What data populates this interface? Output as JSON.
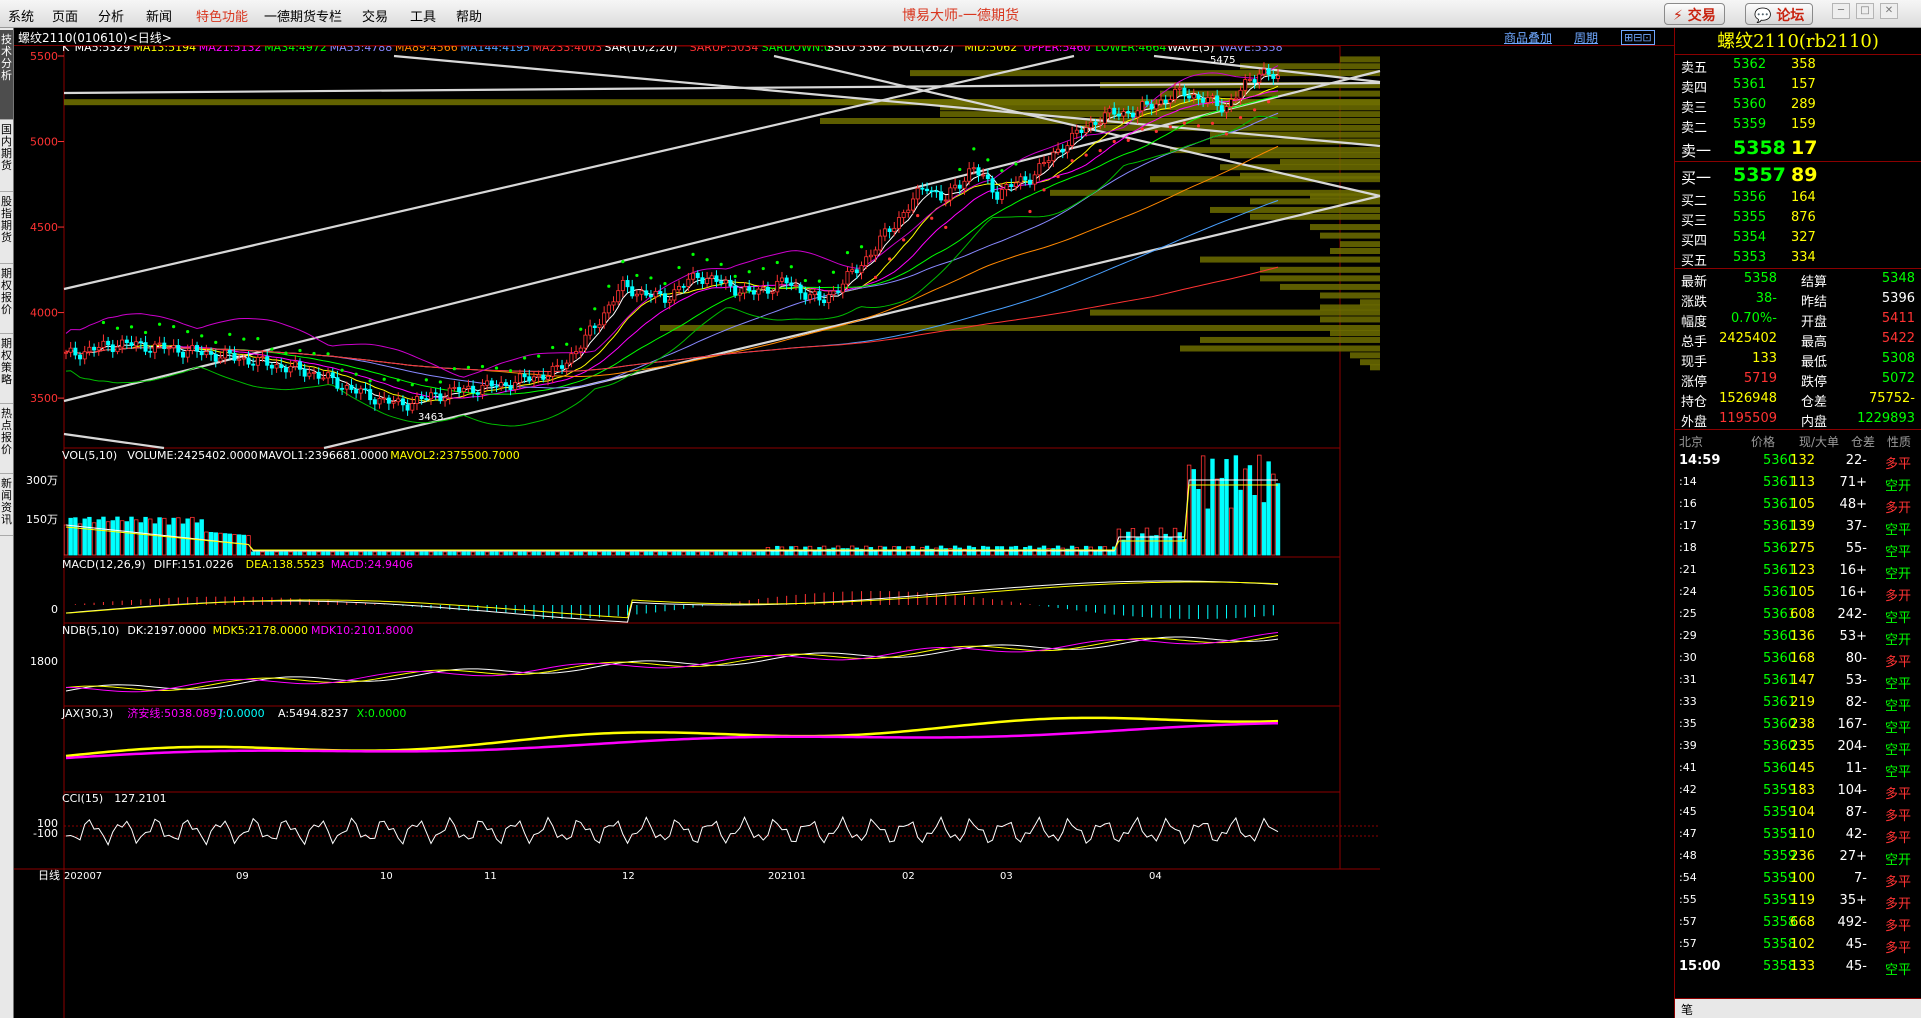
{
  "app_title": "博易大师-一德期货",
  "menu": [
    "系统",
    "页面",
    "分析",
    "新闻",
    "特色功能",
    "一德期货专栏",
    "交易",
    "工具",
    "帮助"
  ],
  "menu_special_index": 4,
  "top_buttons": {
    "trade": "交易",
    "forum": "论坛"
  },
  "left_tabs": [
    "技术分析",
    "国内期货",
    "股指期货",
    "期权报价",
    "期权策略",
    "热点报价",
    "新闻资讯"
  ],
  "chart_header": {
    "symbol": "螺纹2110(010610)<日线>",
    "overlay": "商品叠加",
    "period": "周期"
  },
  "main_indicator": [
    {
      "t": "K",
      "c": "#ffffff"
    },
    {
      "t": "MA5:5329",
      "c": "#ffffff"
    },
    {
      "t": "MA13:5194",
      "c": "#ffff00"
    },
    {
      "t": "MA21:5132",
      "c": "#ff00ff"
    },
    {
      "t": "MA34:4972",
      "c": "#00ff00"
    },
    {
      "t": "MA55:4788",
      "c": "#8888ff"
    },
    {
      "t": "MA89:4566",
      "c": "#ff8800"
    },
    {
      "t": "MA144:4195",
      "c": "#4aa0ff"
    },
    {
      "t": "MA233:4003",
      "c": "#ff3333"
    },
    {
      "t": "SAR(10,2,20)",
      "c": "#ffffff"
    },
    {
      "t": "SARUP:5034",
      "c": "#ff3333"
    },
    {
      "t": "SARDOWN:0",
      "c": "#00ff00"
    },
    {
      "t": "SSLO 5362",
      "c": "#ffffff"
    },
    {
      "t": "BOLL(26,2)",
      "c": "#ffffff"
    },
    {
      "t": "MID:5062",
      "c": "#ffff00"
    },
    {
      "t": "UPPER:5460",
      "c": "#ff00ff"
    },
    {
      "t": "LOWER:4664",
      "c": "#00ff00"
    },
    {
      "t": "WAVE(5)",
      "c": "#ffffff"
    },
    {
      "t": "WAVE:5358",
      "c": "#8888ff"
    }
  ],
  "main_yaxis": [
    "5500",
    "5000",
    "4500",
    "4000",
    "3500"
  ],
  "high_label": "5475",
  "low_label": "3463",
  "vol_indicator": [
    {
      "t": "VOL(5,10)",
      "c": "#ffffff"
    },
    {
      "t": "VOLUME:2425402.0000",
      "c": "#ffffff"
    },
    {
      "t": "MAVOL1:2396681.0000",
      "c": "#ffffff"
    },
    {
      "t": "MAVOL2:2375500.7000",
      "c": "#ffff00"
    }
  ],
  "vol_yaxis": [
    "300万",
    "150万"
  ],
  "macd_indicator": [
    {
      "t": "MACD(12,26,9)",
      "c": "#ffffff"
    },
    {
      "t": "DIFF:151.0226",
      "c": "#ffffff"
    },
    {
      "t": "DEA:138.5523",
      "c": "#ffff00"
    },
    {
      "t": "MACD:24.9406",
      "c": "#ff00ff"
    }
  ],
  "macd_yaxis": [
    "0"
  ],
  "ndb_indicator": [
    {
      "t": "NDB(5,10)",
      "c": "#ffffff"
    },
    {
      "t": "DK:2197.0000",
      "c": "#ffffff"
    },
    {
      "t": "MDK5:2178.0000",
      "c": "#ffff00"
    },
    {
      "t": "MDK10:2101.8000",
      "c": "#ff00ff"
    }
  ],
  "ndb_yaxis": [
    "1800"
  ],
  "jax_indicator": [
    {
      "t": "JAX(30,3)",
      "c": "#ffffff"
    },
    {
      "t": "济安线:5038.0897",
      "c": "#ff00ff"
    },
    {
      "t": "J:0.0000",
      "c": "#00ffff"
    },
    {
      "t": "A:5494.8237",
      "c": "#ffffff"
    },
    {
      "t": "X:0.0000",
      "c": "#00ff00"
    }
  ],
  "cci_indicator": [
    {
      "t": "CCI(15)",
      "c": "#ffffff"
    },
    {
      "t": "127.2101",
      "c": "#ffffff"
    }
  ],
  "cci_yaxis": [
    "100",
    "-100"
  ],
  "xaxis": {
    "label": "日线",
    "ticks": [
      "202007",
      "09",
      "10",
      "11",
      "12",
      "202101",
      "02",
      "03",
      "04"
    ]
  },
  "right": {
    "title": "螺纹2110(rb2110)",
    "asks": [
      [
        "卖五",
        "5362",
        "358"
      ],
      [
        "卖四",
        "5361",
        "157"
      ],
      [
        "卖三",
        "5360",
        "289"
      ],
      [
        "卖二",
        "5359",
        "159"
      ],
      [
        "卖一",
        "5358",
        "17"
      ]
    ],
    "bids": [
      [
        "买一",
        "5357",
        "89"
      ],
      [
        "买二",
        "5356",
        "164"
      ],
      [
        "买三",
        "5355",
        "876"
      ],
      [
        "买四",
        "5354",
        "327"
      ],
      [
        "买五",
        "5353",
        "334"
      ]
    ],
    "quote": [
      [
        "最新",
        "5358",
        "#00ff00",
        "结算",
        "5348",
        "#00ff00"
      ],
      [
        "涨跌",
        "-38",
        "#00ff00",
        "昨结",
        "5396",
        "#ffffff"
      ],
      [
        "幅度",
        "-0.70%",
        "#00ff00",
        "开盘",
        "5411",
        "#ff3333"
      ],
      [
        "总手",
        "2425402",
        "#ffff00",
        "最高",
        "5422",
        "#ff3333"
      ],
      [
        "现手",
        "133",
        "#ffff00",
        "最低",
        "5308",
        "#00ff00"
      ],
      [
        "涨停",
        "5719",
        "#ff3333",
        "跌停",
        "5072",
        "#00ff00"
      ],
      [
        "持仓",
        "1526948",
        "#ffff00",
        "仓差",
        "-75752",
        "#ffff00"
      ],
      [
        "外盘",
        "1195509",
        "#ff3333",
        "内盘",
        "1229893",
        "#00ff00"
      ]
    ],
    "tick_header": [
      "北京",
      "价格",
      "现/大单",
      "仓差",
      "性质"
    ],
    "ticks": [
      [
        "14:59",
        "5360",
        "132",
        "-22",
        "多平"
      ],
      [
        ":14",
        "5361",
        "113",
        "+71",
        "空开"
      ],
      [
        ":16",
        "5361",
        "105",
        "+48",
        "多开"
      ],
      [
        ":17",
        "5361",
        "139",
        "-37",
        "空平"
      ],
      [
        ":18",
        "5361",
        "275",
        "-55",
        "空平"
      ],
      [
        ":21",
        "5361",
        "123",
        "+16",
        "空开"
      ],
      [
        ":24",
        "5361",
        "105",
        "+16",
        "多开"
      ],
      [
        ":25",
        "5361",
        "608",
        "-242",
        "空平"
      ],
      [
        ":29",
        "5360",
        "136",
        "+53",
        "空开"
      ],
      [
        ":30",
        "5360",
        "168",
        "-80",
        "多平"
      ],
      [
        ":31",
        "5361",
        "147",
        "-53",
        "空平"
      ],
      [
        ":33",
        "5361",
        "219",
        "-82",
        "空平"
      ],
      [
        ":35",
        "5360",
        "238",
        "-167",
        "空平"
      ],
      [
        ":39",
        "5360",
        "235",
        "-204",
        "空平"
      ],
      [
        ":41",
        "5360",
        "145",
        "-11",
        "空平"
      ],
      [
        ":42",
        "5359",
        "183",
        "-104",
        "多平"
      ],
      [
        ":45",
        "5359",
        "104",
        "-87",
        "多平"
      ],
      [
        ":47",
        "5359",
        "110",
        "-42",
        "多平"
      ],
      [
        ":48",
        "5359",
        "236",
        "+27",
        "空开"
      ],
      [
        ":54",
        "5359",
        "100",
        "-7",
        "多平"
      ],
      [
        ":55",
        "5359",
        "119",
        "+35",
        "多开"
      ],
      [
        ":57",
        "5358",
        "668",
        "-492",
        "多平"
      ],
      [
        ":57",
        "5358",
        "102",
        "-45",
        "多平"
      ],
      [
        "15:00",
        "5358",
        "133",
        "-45",
        "空平"
      ]
    ],
    "footer": "笔"
  }
}
